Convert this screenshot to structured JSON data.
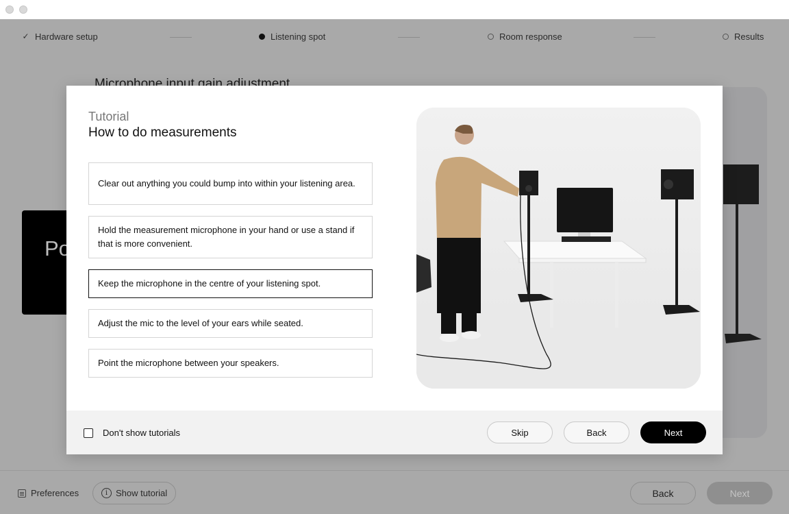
{
  "stepper": {
    "steps": [
      {
        "label": "Hardware setup",
        "state": "completed"
      },
      {
        "label": "Listening spot",
        "state": "current"
      },
      {
        "label": "Room response",
        "state": "pending"
      },
      {
        "label": "Results",
        "state": "pending"
      }
    ]
  },
  "background": {
    "heading": "Microphone input gain adjustment",
    "card_text": "Po"
  },
  "footer": {
    "preferences_label": "Preferences",
    "show_tutorial_label": "Show tutorial",
    "back_label": "Back",
    "next_label": "Next"
  },
  "modal": {
    "kicker": "Tutorial",
    "title": "How to do measurements",
    "tips": [
      "Clear out anything you could bump into within your listening area.",
      "Hold the measurement microphone in your hand or use a stand if that is more convenient.",
      "Keep the microphone in the centre of your listening spot.",
      "Adjust the mic to the level of your ears while seated.",
      "Point the microphone between your speakers."
    ],
    "selected_tip_index": 2,
    "dont_show_label": "Don't show tutorials",
    "dont_show_checked": false,
    "skip_label": "Skip",
    "back_label": "Back",
    "next_label": "Next"
  },
  "colors": {
    "overlay_background": "#a9a9a9",
    "primary_button": "#000000",
    "disabled_button": "#8f8f8f"
  }
}
